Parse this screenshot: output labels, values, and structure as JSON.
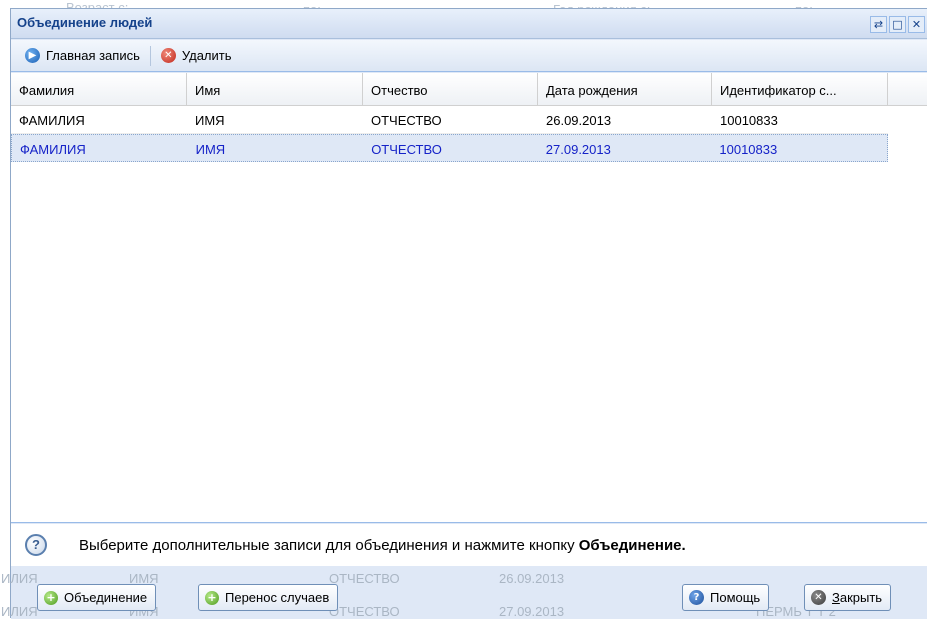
{
  "background": {
    "filter_age_from": "Возраст с:",
    "filter_to_1": "по:",
    "filter_birth_year": "Год рождения с:",
    "filter_to_2": "по:",
    "row1_lastname": "ИЛИЯ",
    "row1_firstname": "ИМЯ",
    "row1_patronymic": "ОТЧЕСТВО",
    "row1_date": "26.09.2013",
    "row2_lastname": "ИЛИЯ",
    "row2_firstname": "ИМЯ",
    "row2_patronymic": "ОТЧЕСТВО",
    "row2_date": "27.09.2013",
    "row2_extra": "ПЕРМЬ Т Т 2"
  },
  "window": {
    "title": "Объединение людей",
    "tool_refresh": "⇄",
    "tool_maximize": "□",
    "tool_close": "✕"
  },
  "toolbar": {
    "main_record": "Главная запись",
    "delete": "Удалить"
  },
  "grid": {
    "columns": [
      "Фамилия",
      "Имя",
      "Отчество",
      "Дата рождения",
      "Идентификатор с..."
    ],
    "rows": [
      {
        "lastname": "ФАМИЛИЯ",
        "firstname": "ИМЯ",
        "patronymic": "ОТЧЕСТВО",
        "birth_date": "26.09.2013",
        "id": "10010833"
      },
      {
        "lastname": "ФАМИЛИЯ",
        "firstname": "ИМЯ",
        "patronymic": "ОТЧЕСТВО",
        "birth_date": "27.09.2013",
        "id": "10010833"
      }
    ],
    "selected_row": 1
  },
  "hint": {
    "icon": "?",
    "text": "Выберите дополнительные записи для объединения и нажмите кнопку ",
    "bold": "Объединение."
  },
  "footer": {
    "merge": "Объединение",
    "transfer": "Перенос случаев",
    "help": "Помощь",
    "close_first": "З",
    "close_rest": "акрыть"
  },
  "colors": {
    "title": "#15428b",
    "selected_text": "#1522c8",
    "window_bg": "#dfe8f6"
  }
}
